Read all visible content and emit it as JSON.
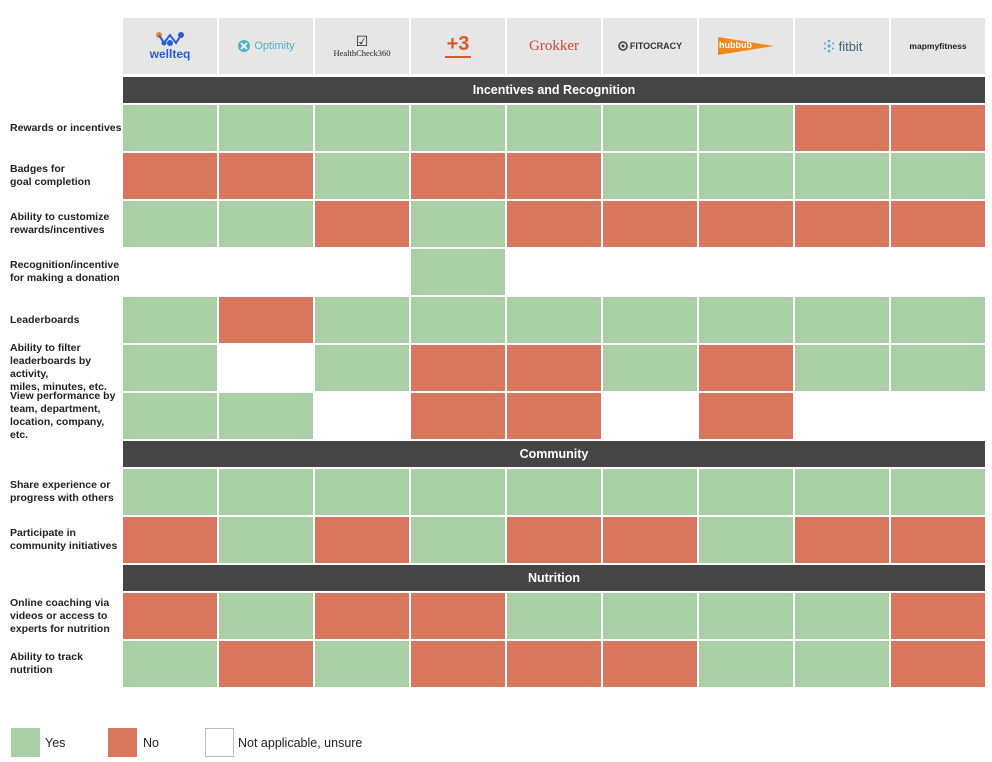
{
  "colors": {
    "yes": "#aacfa6",
    "no": "#d9765e",
    "na": "#ffffff",
    "section": "#454545",
    "logo_bg": "#e6e6e6"
  },
  "products": [
    {
      "name": "wellteq",
      "icon": "wellteq-logo-icon"
    },
    {
      "name": "Optimity",
      "icon": "optimity-logo-icon"
    },
    {
      "name": "HealthCheck360",
      "icon": "checkmark-icon"
    },
    {
      "name": "+3",
      "icon": "plus3-logo-icon"
    },
    {
      "name": "Grokker",
      "icon": "grokker-logo-icon"
    },
    {
      "name": "FITOCRACY",
      "icon": "fitocracy-logo-icon"
    },
    {
      "name": "hubbub",
      "icon": "hubbub-pennant-icon"
    },
    {
      "name": "fitbit",
      "icon": "fitbit-dots-icon"
    },
    {
      "name": "mapmyfitness",
      "icon": "mapmyfitness-logo-icon"
    }
  ],
  "chart_data": {
    "type": "table",
    "columns": [
      "wellteq",
      "Optimity",
      "HealthCheck360",
      "+3",
      "Grokker",
      "FITOCRACY",
      "hubbub",
      "fitbit",
      "mapmyfitness"
    ],
    "sections": [
      {
        "title": "Incentives and Recognition",
        "rows": [
          {
            "label": "Rewards or incentives",
            "values": [
              "Y",
              "Y",
              "Y",
              "Y",
              "Y",
              "Y",
              "Y",
              "N",
              "N"
            ]
          },
          {
            "label": "Badges for\ngoal completion",
            "values": [
              "N",
              "N",
              "Y",
              "N",
              "N",
              "Y",
              "Y",
              "Y",
              "Y"
            ]
          },
          {
            "label": "Ability to customize\nrewards/incentives",
            "values": [
              "Y",
              "Y",
              "N",
              "Y",
              "N",
              "N",
              "N",
              "N",
              "N"
            ]
          },
          {
            "label": "Recognition/incentive\nfor making a donation",
            "values": [
              "-",
              "-",
              "-",
              "Y",
              "-",
              "-",
              "-",
              "-",
              "-"
            ]
          },
          {
            "label": "Leaderboards",
            "values": [
              "Y",
              "N",
              "Y",
              "Y",
              "Y",
              "Y",
              "Y",
              "Y",
              "Y"
            ]
          },
          {
            "label": "Ability to filter\nleaderboards by activity,\nmiles, minutes, etc.",
            "values": [
              "Y",
              "-",
              "Y",
              "N",
              "N",
              "Y",
              "N",
              "Y",
              "Y"
            ]
          },
          {
            "label": "View performance by\nteam, department,\nlocation, company, etc.",
            "values": [
              "Y",
              "Y",
              "-",
              "N",
              "N",
              "-",
              "N",
              "-",
              "-"
            ]
          }
        ]
      },
      {
        "title": "Community",
        "rows": [
          {
            "label": "Share experience or\nprogress with others",
            "values": [
              "Y",
              "Y",
              "Y",
              "Y",
              "Y",
              "Y",
              "Y",
              "Y",
              "Y"
            ]
          },
          {
            "label": "Participate in\ncommunity initiatives",
            "values": [
              "N",
              "Y",
              "N",
              "Y",
              "N",
              "N",
              "Y",
              "N",
              "N"
            ]
          }
        ]
      },
      {
        "title": "Nutrition",
        "rows": [
          {
            "label": "Online coaching via\nvideos or access to\nexperts for nutrition",
            "values": [
              "N",
              "Y",
              "N",
              "N",
              "Y",
              "Y",
              "Y",
              "Y",
              "N"
            ]
          },
          {
            "label": "Ability to track\nnutrition",
            "values": [
              "Y",
              "N",
              "Y",
              "N",
              "N",
              "N",
              "Y",
              "Y",
              "N"
            ]
          }
        ]
      }
    ],
    "legend": [
      {
        "key": "Y",
        "label": "Yes"
      },
      {
        "key": "N",
        "label": "No"
      },
      {
        "key": "-",
        "label": "Not applicable, unsure"
      }
    ]
  }
}
